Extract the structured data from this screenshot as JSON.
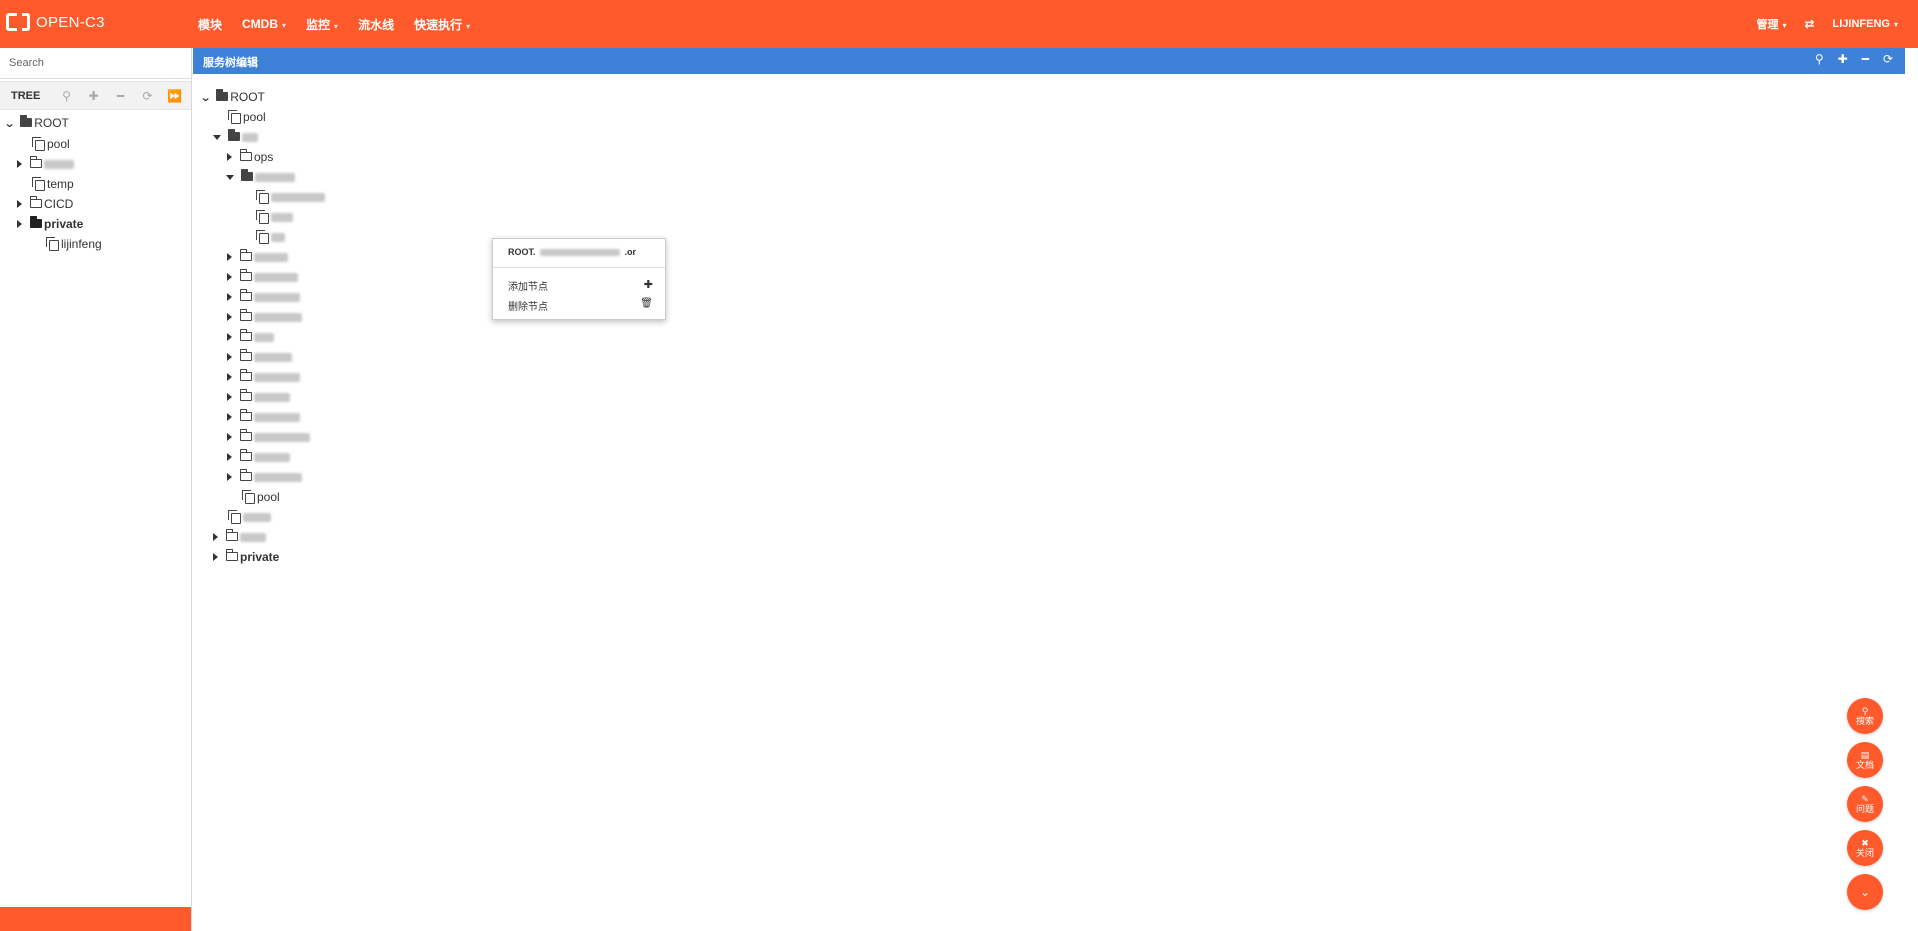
{
  "header": {
    "logo_text": "OPEN-C3",
    "nav": [
      {
        "label": "模块",
        "dropdown": false
      },
      {
        "label": "CMDB",
        "dropdown": true
      },
      {
        "label": "监控",
        "dropdown": true
      },
      {
        "label": "流水线",
        "dropdown": false
      },
      {
        "label": "快速执行",
        "dropdown": true
      }
    ],
    "admin_label": "管理",
    "user_label": "LIJINFENG"
  },
  "sidebar": {
    "search_placeholder": "Search",
    "tree_title": "TREE",
    "nodes": {
      "root": "ROOT",
      "pool": "pool",
      "temp": "temp",
      "cicd": "CICD",
      "private": "private",
      "lijinfeng": "lijinfeng"
    }
  },
  "panel": {
    "title": "服务树编辑",
    "nodes": {
      "root": "ROOT",
      "pool": "pool",
      "ops": "ops",
      "pool2": "pool",
      "private": "private"
    }
  },
  "context_menu": {
    "header": "ROOT.",
    "header_suffix": ".or",
    "add_label": "添加节点",
    "delete_label": "删除节点"
  },
  "fab": {
    "search": "搜索",
    "docs": "文档",
    "issue": "问题",
    "close": "关闭"
  },
  "colors": {
    "brand": "#ff5a2c",
    "panel_header": "#3d82d8"
  }
}
